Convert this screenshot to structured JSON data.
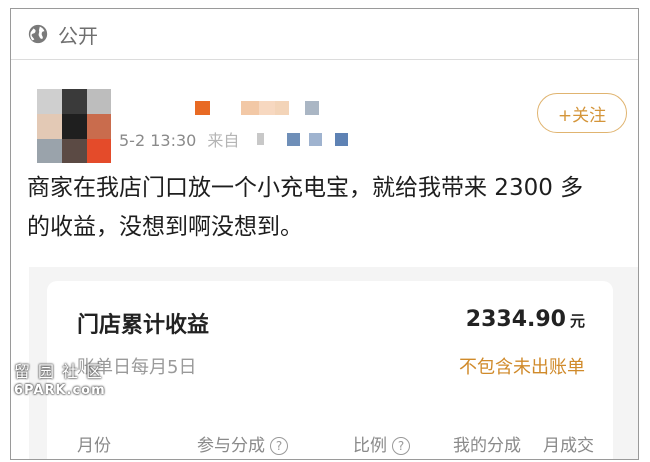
{
  "visibility": {
    "icon": "globe-icon",
    "label": "公开"
  },
  "post": {
    "time": "5-2 13:30",
    "source_prefix": "来自",
    "follow_label": "+关注",
    "text": "商家在我店门口放一个小充电宝，就给我带来 2300 多\n的收益，没想到啊没想到。"
  },
  "card": {
    "title": "门店累计收益",
    "amount": "2334.90",
    "unit": "元",
    "billing_day": "账单日每月5日",
    "note": "不包含未出账单",
    "columns": [
      "月份",
      "参与分成",
      "比例",
      "我的分成",
      "月成交"
    ]
  },
  "watermark": {
    "chinese": "留园社区",
    "english": "6PARK.com"
  },
  "colors": {
    "accent": "#d4953a",
    "follow_border": "#e0b470",
    "text_primary": "#1e1e1e",
    "text_secondary": "#8a8a8a"
  }
}
